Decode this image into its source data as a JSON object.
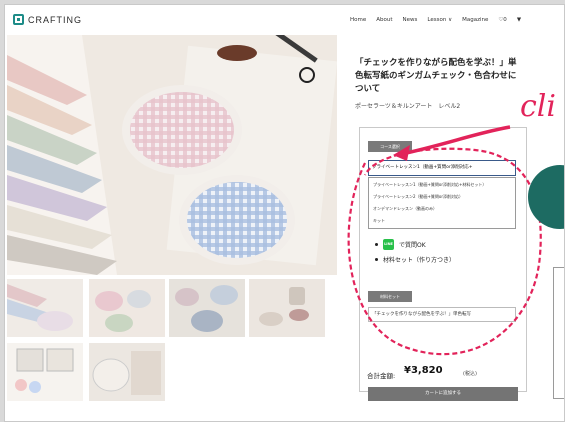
{
  "header": {
    "brand": "CRAFTING",
    "nav": [
      "Home",
      "About",
      "News",
      "Lesson ∨",
      "Magazine",
      "♡0",
      "▼"
    ]
  },
  "product": {
    "title": "「チェックを作りながら配色を学ぶ！」単色転写紙のギンガムチェック・色合わせについて",
    "subtitle": "ポーセラーツ＆キルンアート　レベル2",
    "course_label": "コース選択",
    "selected_option": "プライベートレッスン1（動画+質問or添削対応+",
    "options": [
      "プライベートレッスン1（動画+質問or添削対応+材料セット）",
      "プライベートレッスン2（動画+質問or添削対応）",
      "オンデマンドレッスン（動画のみ）",
      "キット"
    ],
    "features": [
      "で質問OK",
      "材料セット（作り方つき）"
    ],
    "line_badge": "LINE",
    "set_label": "材料セット",
    "set_value": "「チェックを作りながら配色を学ぶ！」単色転写",
    "total_label": "合計金額:",
    "total_price": "¥3,820",
    "tax_note": "(税込)",
    "cart_button": "カートに追加する"
  },
  "annotation": {
    "text": "cli",
    "color": "#e2235a"
  },
  "colors": {
    "accent": "#1d8c88",
    "annotation": "#e2235a",
    "button": "#747474"
  }
}
